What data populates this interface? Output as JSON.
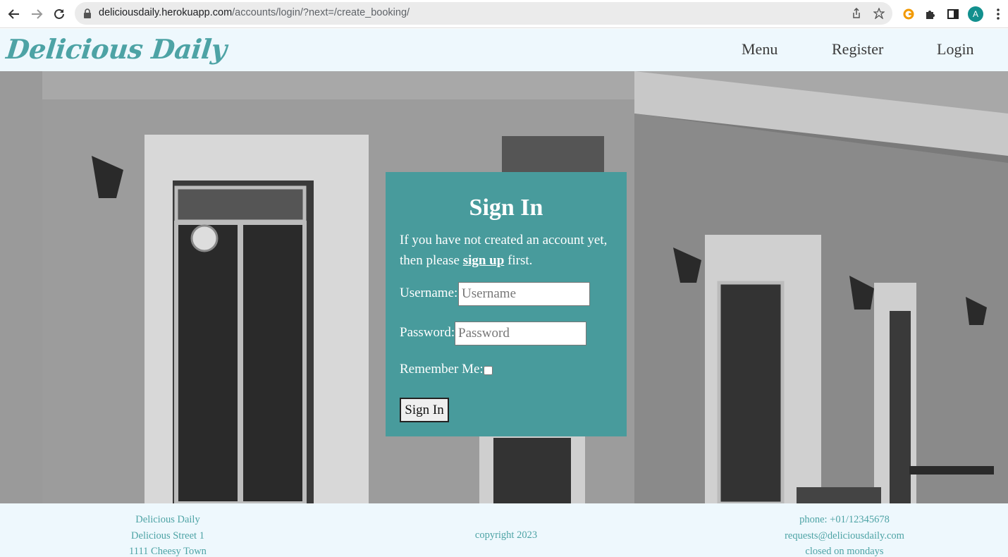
{
  "browser": {
    "url_host": "deliciousdaily.herokuapp.com",
    "url_path": "/accounts/login/?next=/create_booking/",
    "profile_initial": "A",
    "icons": [
      "back-arrow-icon",
      "forward-arrow-icon",
      "reload-icon",
      "lock-icon",
      "share-icon",
      "star-icon",
      "extension-g-icon",
      "puzzle-icon",
      "side-panel-icon",
      "profile-avatar",
      "kebab-menu-icon"
    ]
  },
  "header": {
    "brand": "Delicious Daily",
    "nav": [
      "Menu",
      "Register",
      "Login"
    ]
  },
  "signin": {
    "title": "Sign In",
    "intro_before": "If you have not created an account yet, then please ",
    "intro_link": "sign up",
    "intro_after": " first.",
    "username_label": "Username:",
    "username_placeholder": "Username",
    "username_value": "",
    "password_label": "Password:",
    "password_placeholder": "Password",
    "password_value": "",
    "remember_label": "Remember Me:",
    "remember_checked": false,
    "submit_label": "Sign In"
  },
  "footer": {
    "address": [
      "Delicious Daily",
      "Delicious Street 1",
      "1111 Cheesy Town"
    ],
    "copyright": "copyright 2023",
    "contact": [
      "phone: +01/12345678",
      "requests@deliciousdaily.com",
      "closed on mondays"
    ]
  },
  "colors": {
    "accent": "#4da3a5",
    "card": "#489b9c",
    "header_bg": "#eef8fd"
  }
}
